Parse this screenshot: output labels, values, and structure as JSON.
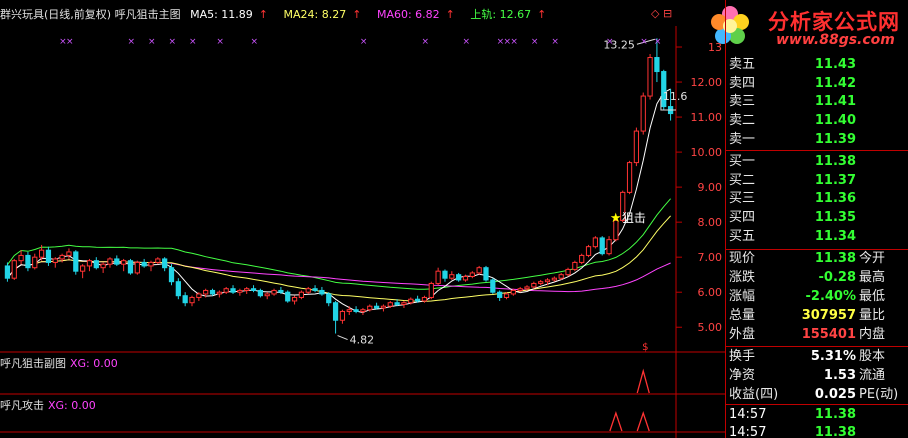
{
  "header": {
    "title": "群兴玩具(日线,前复权) 呼凡狙击主图",
    "ma5_label": "MA5: 11.89",
    "ma24_label": "MA24: 8.27",
    "ma60_label": "MA60: 6.82",
    "upper_label": "上轨: 12.67",
    "arrow": "↑",
    "corner_icons": "◇ ⊟"
  },
  "logo": {
    "name": "分析家公式网",
    "url": "www.88gs.com"
  },
  "chart_data": {
    "type": "candlestick",
    "y_ticks": [
      "13",
      "12.00",
      "11.00",
      "10.00",
      "9.00",
      "8.00",
      "7.00",
      "6.00",
      "5.00"
    ],
    "y_tick_values": [
      13,
      12,
      11,
      10,
      9,
      8,
      7,
      6,
      5
    ],
    "ylim": [
      4.35,
      13.6
    ],
    "annotations": {
      "high": "13.25",
      "low": "4.82",
      "right_price": "11.6",
      "signal": "狙击",
      "signal_icon": "★"
    },
    "candles": [
      [
        6.75,
        6.85,
        6.3,
        6.4
      ],
      [
        6.4,
        6.95,
        6.35,
        6.9
      ],
      [
        6.9,
        7.2,
        6.8,
        7.05
      ],
      [
        7.05,
        7.15,
        6.6,
        6.7
      ],
      [
        6.7,
        7.1,
        6.65,
        7.0
      ],
      [
        7.0,
        7.35,
        6.9,
        7.2
      ],
      [
        7.2,
        7.3,
        6.75,
        6.85
      ],
      [
        6.85,
        7.0,
        6.7,
        6.95
      ],
      [
        6.95,
        7.1,
        6.85,
        7.05
      ],
      [
        7.05,
        7.25,
        6.95,
        7.15
      ],
      [
        7.15,
        7.2,
        6.5,
        6.6
      ],
      [
        6.6,
        6.8,
        6.4,
        6.75
      ],
      [
        6.75,
        6.95,
        6.6,
        6.9
      ],
      [
        6.9,
        7.0,
        6.65,
        6.7
      ],
      [
        6.7,
        6.85,
        6.55,
        6.8
      ],
      [
        6.8,
        7.0,
        6.7,
        6.95
      ],
      [
        6.95,
        7.05,
        6.75,
        6.8
      ],
      [
        6.8,
        6.95,
        6.6,
        6.9
      ],
      [
        6.9,
        6.95,
        6.5,
        6.55
      ],
      [
        6.55,
        6.9,
        6.5,
        6.85
      ],
      [
        6.85,
        6.95,
        6.7,
        6.75
      ],
      [
        6.75,
        6.9,
        6.6,
        6.85
      ],
      [
        6.85,
        7.0,
        6.8,
        6.95
      ],
      [
        6.95,
        7.0,
        6.6,
        6.7
      ],
      [
        6.7,
        6.8,
        6.2,
        6.3
      ],
      [
        6.3,
        6.4,
        5.8,
        5.9
      ],
      [
        5.9,
        6.0,
        5.6,
        5.7
      ],
      [
        5.7,
        5.9,
        5.6,
        5.85
      ],
      [
        5.85,
        6.0,
        5.75,
        5.95
      ],
      [
        5.95,
        6.1,
        5.85,
        6.05
      ],
      [
        6.05,
        6.1,
        5.9,
        5.95
      ],
      [
        5.95,
        6.05,
        5.85,
        6.0
      ],
      [
        6.0,
        6.15,
        5.95,
        6.1
      ],
      [
        6.1,
        6.2,
        5.95,
        6.0
      ],
      [
        6.0,
        6.1,
        5.9,
        6.05
      ],
      [
        6.05,
        6.15,
        5.95,
        6.1
      ],
      [
        6.1,
        6.2,
        6.0,
        6.05
      ],
      [
        6.05,
        6.1,
        5.85,
        5.9
      ],
      [
        5.9,
        6.0,
        5.8,
        5.95
      ],
      [
        5.95,
        6.1,
        5.9,
        6.05
      ],
      [
        6.05,
        6.15,
        5.95,
        6.0
      ],
      [
        6.0,
        6.05,
        5.7,
        5.75
      ],
      [
        5.75,
        5.9,
        5.65,
        5.85
      ],
      [
        5.85,
        6.05,
        5.8,
        6.0
      ],
      [
        6.0,
        6.15,
        5.95,
        6.1
      ],
      [
        6.1,
        6.2,
        6.0,
        6.05
      ],
      [
        6.05,
        6.15,
        5.9,
        5.95
      ],
      [
        5.95,
        6.0,
        5.6,
        5.7
      ],
      [
        5.7,
        5.75,
        4.82,
        5.2
      ],
      [
        5.2,
        5.5,
        5.1,
        5.45
      ],
      [
        5.45,
        5.6,
        5.35,
        5.5
      ],
      [
        5.5,
        5.6,
        5.4,
        5.45
      ],
      [
        5.45,
        5.55,
        5.35,
        5.5
      ],
      [
        5.5,
        5.65,
        5.45,
        5.6
      ],
      [
        5.6,
        5.7,
        5.5,
        5.55
      ],
      [
        5.55,
        5.65,
        5.45,
        5.6
      ],
      [
        5.6,
        5.75,
        5.55,
        5.7
      ],
      [
        5.7,
        5.8,
        5.6,
        5.65
      ],
      [
        5.65,
        5.75,
        5.55,
        5.7
      ],
      [
        5.7,
        5.85,
        5.65,
        5.8
      ],
      [
        5.8,
        5.9,
        5.7,
        5.75
      ],
      [
        5.75,
        5.9,
        5.7,
        5.85
      ],
      [
        5.85,
        6.3,
        5.8,
        6.25
      ],
      [
        6.25,
        6.7,
        6.2,
        6.6
      ],
      [
        6.6,
        6.65,
        6.3,
        6.4
      ],
      [
        6.4,
        6.6,
        6.35,
        6.5
      ],
      [
        6.5,
        6.55,
        6.3,
        6.35
      ],
      [
        6.35,
        6.5,
        6.3,
        6.45
      ],
      [
        6.45,
        6.6,
        6.4,
        6.55
      ],
      [
        6.55,
        6.75,
        6.5,
        6.7
      ],
      [
        6.7,
        6.75,
        6.3,
        6.35
      ],
      [
        6.35,
        6.4,
        5.95,
        6.0
      ],
      [
        6.0,
        6.05,
        5.75,
        5.85
      ],
      [
        5.85,
        6.0,
        5.8,
        5.95
      ],
      [
        5.95,
        6.1,
        5.9,
        6.05
      ],
      [
        6.05,
        6.15,
        6.0,
        6.1
      ],
      [
        6.1,
        6.2,
        6.05,
        6.15
      ],
      [
        6.15,
        6.3,
        6.1,
        6.25
      ],
      [
        6.25,
        6.35,
        6.2,
        6.3
      ],
      [
        6.3,
        6.4,
        6.2,
        6.35
      ],
      [
        6.35,
        6.45,
        6.3,
        6.4
      ],
      [
        6.4,
        6.55,
        6.35,
        6.5
      ],
      [
        6.5,
        6.7,
        6.45,
        6.65
      ],
      [
        6.65,
        6.9,
        6.6,
        6.85
      ],
      [
        6.85,
        7.1,
        6.8,
        7.05
      ],
      [
        7.05,
        7.35,
        7.0,
        7.3
      ],
      [
        7.3,
        7.6,
        7.25,
        7.55
      ],
      [
        7.55,
        7.6,
        7.05,
        7.1
      ],
      [
        7.1,
        7.6,
        7.05,
        7.5
      ],
      [
        7.5,
        8.1,
        7.45,
        8.05
      ],
      [
        8.05,
        8.9,
        8.0,
        8.85
      ],
      [
        8.85,
        9.75,
        8.8,
        9.7
      ],
      [
        9.7,
        10.7,
        9.6,
        10.6
      ],
      [
        10.6,
        11.7,
        10.5,
        11.6
      ],
      [
        11.6,
        12.8,
        11.5,
        12.7
      ],
      [
        12.7,
        13.25,
        12.0,
        12.3
      ],
      [
        12.3,
        12.35,
        11.2,
        11.3
      ],
      [
        11.3,
        11.8,
        10.9,
        11.1
      ]
    ]
  },
  "sub_panels": [
    {
      "name": "呼凡狙击副图",
      "value": "XG: 0.00"
    },
    {
      "name": "呼凡攻击",
      "value": "XG: 0.00"
    }
  ],
  "quote": {
    "sell": [
      {
        "label": "卖五",
        "price": "11.43"
      },
      {
        "label": "卖四",
        "price": "11.42"
      },
      {
        "label": "卖三",
        "price": "11.41"
      },
      {
        "label": "卖二",
        "price": "11.40"
      },
      {
        "label": "卖一",
        "price": "11.39"
      }
    ],
    "buy": [
      {
        "label": "买一",
        "price": "11.38"
      },
      {
        "label": "买二",
        "price": "11.37"
      },
      {
        "label": "买三",
        "price": "11.36"
      },
      {
        "label": "买四",
        "price": "11.35"
      },
      {
        "label": "买五",
        "price": "11.34"
      }
    ],
    "stats": [
      {
        "label": "现价",
        "value": "11.38",
        "label2": "今开",
        "color": "green"
      },
      {
        "label": "涨跌",
        "value": "-0.28",
        "label2": "最高",
        "color": "green"
      },
      {
        "label": "涨幅",
        "value": "-2.40%",
        "label2": "最低",
        "color": "green"
      },
      {
        "label": "总量",
        "value": "307957",
        "label2": "量比",
        "color": "yellow"
      },
      {
        "label": "外盘",
        "value": "155401",
        "label2": "内盘",
        "color": "red"
      }
    ],
    "fundamentals": [
      {
        "label": "换手",
        "value": "5.31%",
        "label2": "股本"
      },
      {
        "label": "净资",
        "value": "1.53",
        "label2": "流通"
      },
      {
        "label": "收益(四)",
        "value": "0.025",
        "label2": "PE(动)"
      }
    ],
    "ticks": [
      {
        "time": "14:57",
        "price": "11.38"
      },
      {
        "time": "14:57",
        "price": "11.38"
      }
    ]
  },
  "colors": {
    "up": "#ff3333",
    "down": "#22d4e6",
    "ma5": "#ffffff",
    "ma24": "#ffff66",
    "ma60": "#ff44ff",
    "upper": "#44ff44",
    "grid": "#c00000"
  }
}
